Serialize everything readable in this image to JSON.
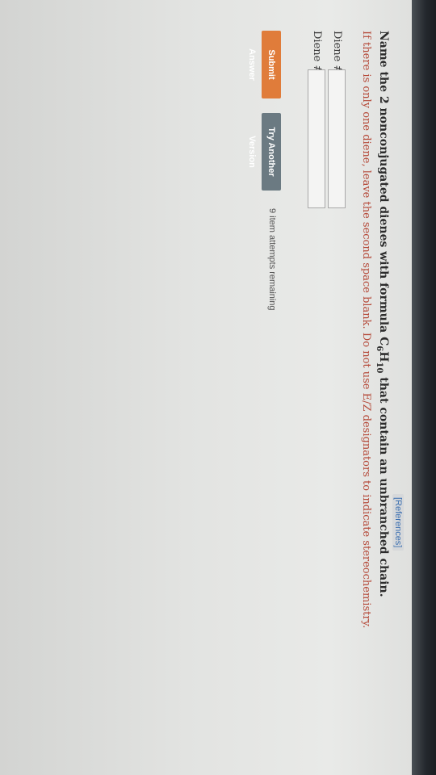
{
  "header": {
    "references_label": "[References]"
  },
  "question": {
    "prefix": "Name the 2 nonconjugated dienes with formula C",
    "sub1": "6",
    "middle": "H",
    "sub2": "10",
    "suffix": " that contain an unbranched chain."
  },
  "instruction": "If there is only one diene, leave the second space blank. Do not use E/Z designators to indicate stereochemistry.",
  "fields": [
    {
      "label": "Diene #1:",
      "value": ""
    },
    {
      "label": "Diene #2:",
      "value": ""
    }
  ],
  "buttons": {
    "submit": "Submit Answer",
    "try_another": "Try Another Version"
  },
  "attempts_text": "9 item attempts remaining",
  "colors": {
    "submit_button": "#e07c3a",
    "try_button": "#6b7a82",
    "instruction_text": "#b54a3a",
    "references_link": "#3b6fb0"
  }
}
